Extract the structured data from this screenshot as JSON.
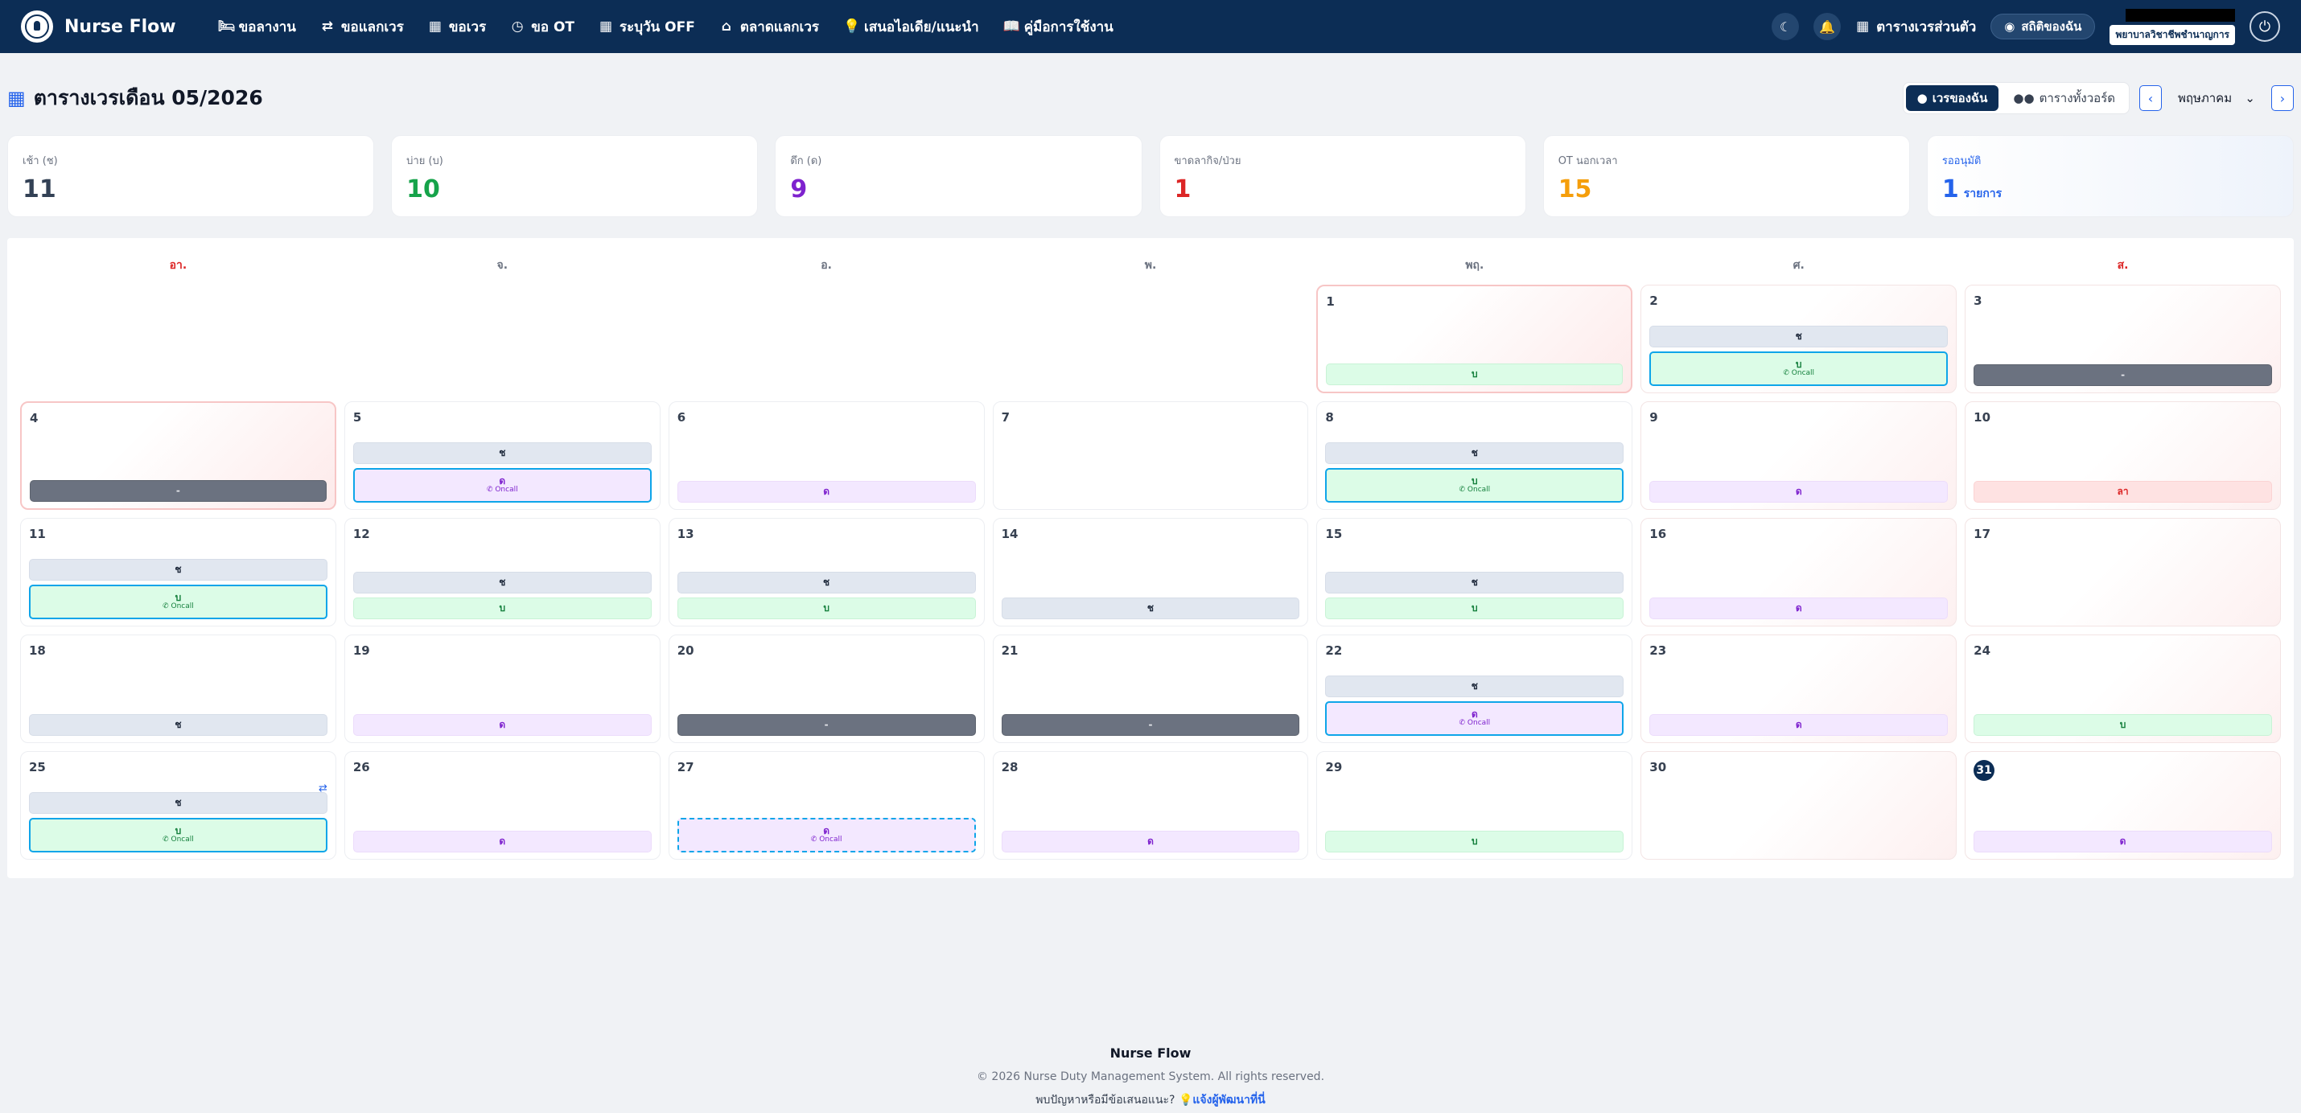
{
  "nav": {
    "brand": "Nurse Flow",
    "items": [
      {
        "label": "ขอลางาน",
        "icon": "bed-icon"
      },
      {
        "label": "ขอแลกเวร",
        "icon": "swap-icon"
      },
      {
        "label": "ขอเวร",
        "icon": "calendar-icon"
      },
      {
        "label": "ขอ OT",
        "icon": "clock-icon"
      },
      {
        "label": "ระบุวัน OFF",
        "icon": "calendar-off-icon"
      },
      {
        "label": "ตลาดแลกเวร",
        "icon": "store-icon"
      },
      {
        "label": "เสนอไอเดีย/แนะนำ",
        "icon": "lightbulb-icon"
      },
      {
        "label": "คู่มือการใช้งาน",
        "icon": "book-icon"
      }
    ],
    "personal_schedule": "ตารางเวรส่วนตัว",
    "my_stats": "สถิติของฉัน",
    "user_role": "พยาบาลวิชาชีพชำนาญการ"
  },
  "header": {
    "title": "ตารางเวรเดือน 05/2026",
    "my_shifts": "เวรของฉัน",
    "full_schedule": "ตารางทั้งวอร์ด",
    "month": "พฤษภาคม"
  },
  "stats": [
    {
      "label": "เช้า (ช)",
      "value": "11",
      "color": "#334155"
    },
    {
      "label": "บ่าย (บ)",
      "value": "10",
      "color": "#16a34a"
    },
    {
      "label": "ดึก (ด)",
      "value": "9",
      "color": "#7e22ce"
    },
    {
      "label": "ขาดลากิจ/ป่วย",
      "value": "1",
      "color": "#dc2626"
    },
    {
      "label": "OT นอกเวลา",
      "value": "15",
      "color": "#f59e0b"
    },
    {
      "label": "รออนุมัติ",
      "value": "1",
      "unit": "รายการ",
      "color": "#2563eb"
    }
  ],
  "calendar": {
    "weekdays": [
      "อา.",
      "จ.",
      "อ.",
      "พ.",
      "พฤ.",
      "ศ.",
      "ส."
    ],
    "oncall_label": "Oncall",
    "days": [
      {
        "blank": true
      },
      {
        "blank": true
      },
      {
        "blank": true
      },
      {
        "blank": true
      },
      {
        "num": "1",
        "holiday": true,
        "shifts": [
          {
            "t": "evening",
            "l": "บ"
          }
        ]
      },
      {
        "num": "2",
        "weekend": true,
        "shifts": [
          {
            "t": "morning",
            "l": "ช"
          },
          {
            "t": "evening",
            "l": "บ",
            "oncall": true
          }
        ]
      },
      {
        "num": "3",
        "weekend": true,
        "shifts": [
          {
            "t": "off",
            "l": "-"
          }
        ]
      },
      {
        "num": "4",
        "holiday": true,
        "shifts": [
          {
            "t": "off",
            "l": "-"
          }
        ]
      },
      {
        "num": "5",
        "shifts": [
          {
            "t": "morning",
            "l": "ช"
          },
          {
            "t": "night",
            "l": "ด",
            "oncall": true
          }
        ]
      },
      {
        "num": "6",
        "shifts": [
          {
            "t": "night",
            "l": "ด"
          }
        ]
      },
      {
        "num": "7",
        "shifts": []
      },
      {
        "num": "8",
        "shifts": [
          {
            "t": "morning",
            "l": "ช"
          },
          {
            "t": "evening",
            "l": "บ",
            "oncall": true
          }
        ]
      },
      {
        "num": "9",
        "weekend": true,
        "shifts": [
          {
            "t": "night",
            "l": "ด"
          }
        ]
      },
      {
        "num": "10",
        "weekend": true,
        "shifts": [
          {
            "t": "leave",
            "l": "ลา"
          }
        ]
      },
      {
        "num": "11",
        "shifts": [
          {
            "t": "morning",
            "l": "ช"
          },
          {
            "t": "evening",
            "l": "บ",
            "oncall": true
          }
        ]
      },
      {
        "num": "12",
        "shifts": [
          {
            "t": "morning",
            "l": "ช"
          },
          {
            "t": "evening",
            "l": "บ"
          }
        ]
      },
      {
        "num": "13",
        "shifts": [
          {
            "t": "morning",
            "l": "ช"
          },
          {
            "t": "evening",
            "l": "บ"
          }
        ]
      },
      {
        "num": "14",
        "shifts": [
          {
            "t": "morning",
            "l": "ช"
          }
        ]
      },
      {
        "num": "15",
        "shifts": [
          {
            "t": "morning",
            "l": "ช"
          },
          {
            "t": "evening",
            "l": "บ"
          }
        ]
      },
      {
        "num": "16",
        "weekend": true,
        "shifts": [
          {
            "t": "night",
            "l": "ด"
          }
        ]
      },
      {
        "num": "17",
        "weekend": true,
        "shifts": []
      },
      {
        "num": "18",
        "shifts": [
          {
            "t": "morning",
            "l": "ช"
          }
        ]
      },
      {
        "num": "19",
        "shifts": [
          {
            "t": "night",
            "l": "ด"
          }
        ]
      },
      {
        "num": "20",
        "shifts": [
          {
            "t": "off",
            "l": "-"
          }
        ]
      },
      {
        "num": "21",
        "shifts": [
          {
            "t": "off",
            "l": "-"
          }
        ]
      },
      {
        "num": "22",
        "shifts": [
          {
            "t": "morning",
            "l": "ช"
          },
          {
            "t": "night",
            "l": "ด",
            "oncall": true
          }
        ]
      },
      {
        "num": "23",
        "weekend": true,
        "shifts": [
          {
            "t": "night",
            "l": "ด"
          }
        ]
      },
      {
        "num": "24",
        "weekend": true,
        "shifts": [
          {
            "t": "evening",
            "l": "บ"
          }
        ]
      },
      {
        "num": "25",
        "swap": true,
        "shifts": [
          {
            "t": "morning",
            "l": "ช"
          },
          {
            "t": "evening",
            "l": "บ",
            "oncall": true
          }
        ]
      },
      {
        "num": "26",
        "shifts": [
          {
            "t": "night",
            "l": "ด"
          }
        ]
      },
      {
        "num": "27",
        "shifts": [
          {
            "t": "night",
            "l": "ด",
            "oncall": true,
            "pending": true
          }
        ]
      },
      {
        "num": "28",
        "shifts": [
          {
            "t": "night",
            "l": "ด"
          }
        ]
      },
      {
        "num": "29",
        "shifts": [
          {
            "t": "evening",
            "l": "บ"
          }
        ]
      },
      {
        "num": "30",
        "weekend": true,
        "shifts": []
      },
      {
        "num": "31",
        "weekend": true,
        "today": true,
        "shifts": [
          {
            "t": "night",
            "l": "ด"
          }
        ]
      }
    ]
  },
  "footer": {
    "title": "Nurse Flow",
    "copyright": "© 2026 Nurse Duty Management System. All rights reserved.",
    "help_text": "พบปัญหาหรือมีข้อเสนอแนะ?",
    "help_link": "แจ้งผู้พัฒนาที่นี่"
  }
}
